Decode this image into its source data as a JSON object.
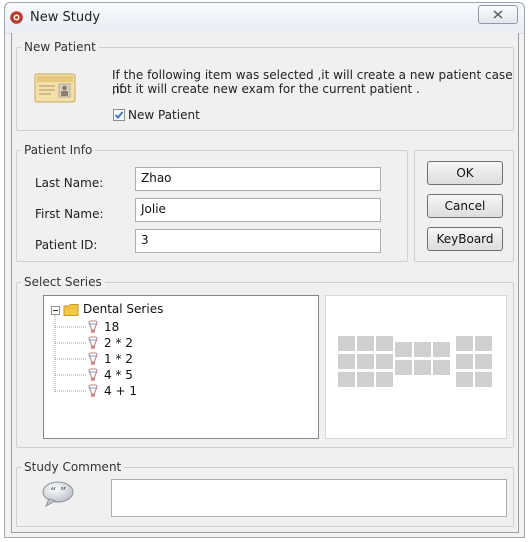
{
  "window": {
    "title": "New Study",
    "close_glyph": "⌧"
  },
  "new_patient": {
    "group_label": "New Patient",
    "description_line1": "If the following item was selected ,it will create a new patient case ,if",
    "description_line2": "not it will create  new exam for the current patient .",
    "checkbox_label": "New Patient",
    "checkbox_checked": true
  },
  "patient_info": {
    "group_label": "Patient Info",
    "last_name_label": "Last Name:",
    "last_name_value": "Zhao",
    "first_name_label": "First Name:",
    "first_name_value": "Jolie",
    "patient_id_label": "Patient ID:",
    "patient_id_value": "3"
  },
  "buttons": {
    "ok": "OK",
    "cancel": "Cancel",
    "keyboard": "KeyBoard"
  },
  "select_series": {
    "group_label": "Select Series",
    "root": "Dental Series",
    "items": [
      "18",
      "2 * 2",
      "1 * 2",
      "4 * 5",
      "4 + 1"
    ]
  },
  "study_comment": {
    "group_label": "Study Comment",
    "value": ""
  },
  "colors": {
    "accent": "#3c6fc2",
    "folder": "#f5c84a",
    "preview_block": "#cfcfcf"
  }
}
